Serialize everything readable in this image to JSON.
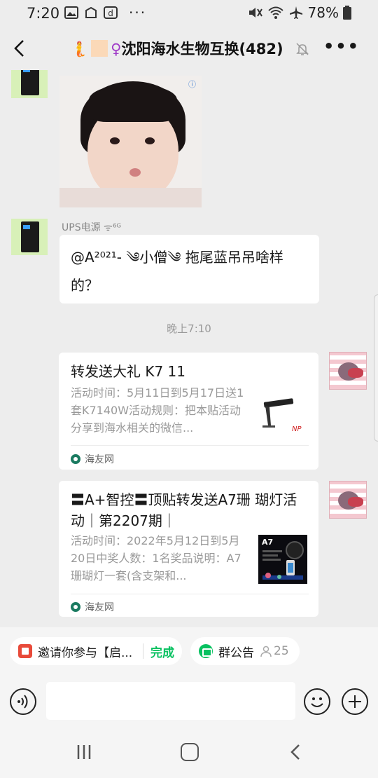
{
  "status_bar": {
    "time": "7:20",
    "dots": "···",
    "battery_percent": "78%"
  },
  "header": {
    "title_emoji": "🧜",
    "title_symbol": "♀",
    "title_text": "沈阳海水生物互换(482)"
  },
  "chat": {
    "message_1": {
      "sender": "UPS电源",
      "type": "image",
      "image_mark": "ⓘ"
    },
    "message_2": {
      "sender": "UPS电源",
      "sender_signal": "ᯤ⁶ᴳ",
      "text": "@A²⁰²¹- ༄小僧༄ 拖尾蓝吊吊啥样的？"
    },
    "timestamp": "晚上7:10",
    "card_1": {
      "title": "转发送大礼 K7 11",
      "description": "活动时间：5月11日到5月17日送1套K7140W活动规则：把本贴活动分享到海水相关的微信...",
      "source": "海友网"
    },
    "card_2": {
      "title": "〓A+智控〓顶贴转发送A7珊 瑚灯活动｜第2207期｜",
      "description": "活动时间：2022年5月12日到5月20日中奖人数：1名奖品说明：A7珊瑚灯一套(含支架和...",
      "thumb_label": "A7",
      "source": "海友网"
    }
  },
  "pills": {
    "invite_text": "邀请你参与【启...",
    "invite_action": "完成",
    "notice_label": "群公告",
    "notice_count": "25"
  },
  "colors": {
    "accent_green": "#07c160",
    "background": "#ededed"
  }
}
